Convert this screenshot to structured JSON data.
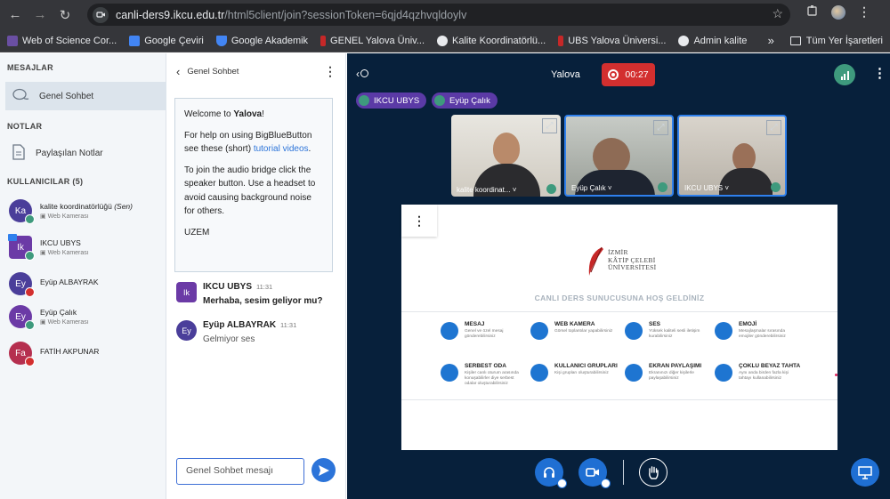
{
  "browser": {
    "url_domain": "canli-ders9.ikcu.edu.tr",
    "url_path": "/html5client/join?sessionToken=6qjd4qzhvqldoylv",
    "bookmarks": [
      {
        "label": "Web of Science Cor...",
        "color": "#5f6368"
      },
      {
        "label": "Google Çeviri",
        "color": "#4285f4"
      },
      {
        "label": "Google Akademik",
        "color": "#4285f4"
      },
      {
        "label": "GENEL Yalova Üniv...",
        "color": "#c62828"
      },
      {
        "label": "Kalite Koordinatörlü...",
        "color": "#e8eaed"
      },
      {
        "label": "UBS Yalova Üniversi...",
        "color": "#c62828"
      },
      {
        "label": "Admin kalite",
        "color": "#e8eaed"
      }
    ],
    "more": "»",
    "all_bookmarks": "Tüm Yer İşaretleri"
  },
  "sidebar": {
    "messages_header": "MESAJLAR",
    "public_chat": "Genel Sohbet",
    "notes_header": "NOTLAR",
    "shared_notes": "Paylaşılan Notlar",
    "users_header": "KULLANICILAR (5)",
    "users": [
      {
        "initials": "Ka",
        "name": "kalite koordinatörlüğü",
        "you": "(Sen)",
        "sub": "Web Kamerası",
        "color": "#4a3e9a",
        "badge": "#3e9a7d",
        "shape": "circle"
      },
      {
        "initials": "Ik",
        "name": "IKCU UBYS",
        "you": "",
        "sub": "Web Kamerası",
        "color": "#6b3aa6",
        "badge": "#3e9a7d",
        "shape": "square"
      },
      {
        "initials": "Ey",
        "name": "Eyüp ALBAYRAK",
        "you": "",
        "sub": "",
        "color": "#4a3e9a",
        "badge": "#d32f2f",
        "shape": "circle"
      },
      {
        "initials": "Ey",
        "name": "Eyüp Çalık",
        "you": "",
        "sub": "Web Kamerası",
        "color": "#6b3aa6",
        "badge": "#3e9a7d",
        "shape": "circle"
      },
      {
        "initials": "Fa",
        "name": "FATİH AKPUNAR",
        "you": "",
        "sub": "",
        "color": "#b52f4f",
        "badge": "#d32f2f",
        "shape": "circle"
      }
    ]
  },
  "chat": {
    "title": "Genel Sohbet",
    "welcome_title_prefix": "Welcome to ",
    "welcome_title_name": "Yalova",
    "welcome_title_suffix": "!",
    "help_text": "For help on using BigBlueButton see these (short) ",
    "help_link": "tutorial videos",
    "help_end": ".",
    "audio_text": "To join the audio bridge click the speaker button. Use a headset to avoid causing background noise for others.",
    "signature": "UZEM",
    "messages": [
      {
        "initials": "Ik",
        "name": "IKCU UBYS",
        "time": "11:31",
        "text": "Merhaba, sesim geliyor mu?",
        "color": "#6b3aa6",
        "bold": true
      },
      {
        "initials": "Ey",
        "name": "Eyüp ALBAYRAK",
        "time": "11:31",
        "text": "Gelmiyor ses",
        "color": "#4a3e9a",
        "bold": false
      }
    ],
    "input_placeholder": "Genel Sohbet mesajı"
  },
  "meeting": {
    "title": "Yalova",
    "recording_time": "00:27",
    "talking": [
      "IKCU UBYS",
      "Eyüp Çalık"
    ],
    "videos": [
      {
        "name": "kalite koordinat...",
        "speaking": false
      },
      {
        "name": "Eyüp Çalık",
        "speaking": true
      },
      {
        "name": "IKCU UBYS",
        "speaking": true
      }
    ]
  },
  "slide": {
    "university_line1": "İZMİR",
    "university_line2": "KÂTİP ÇELEBİ",
    "university_line3": "ÜNİVERSİTESİ",
    "welcome": "CANLI DERS SUNUCUSUNA HOŞ GELDİNİZ",
    "features": [
      {
        "title": "MESAJ",
        "desc": "Genel ve özel mesaj gönderebilirsiniz"
      },
      {
        "title": "WEB KAMERA",
        "desc": "Görsel toplantılar yapabilirsiniz"
      },
      {
        "title": "SES",
        "desc": "Yüksek kaliteli sesli iletişim kurabilirsiniz"
      },
      {
        "title": "EMOJİ",
        "desc": "Mesajlaşmalar sırasında emojiler gönderebilirsiniz"
      },
      {
        "title": "SERBEST ODA",
        "desc": "Kişiler canlı oturum arasında konuşabilirler diye serbest odalar oluşturabilirsiniz"
      },
      {
        "title": "KULLANICI GRUPLARI",
        "desc": "Kişi grupları oluşturabilirsiniz"
      },
      {
        "title": "EKRAN PAYLAŞIMI",
        "desc": "Ekranınızı diğer kişilerle paylaşabilirsiniz"
      },
      {
        "title": "ÇOKLU BEYAZ TAHTA",
        "desc": "Aynı anda birden fazla kişi tahtayı kullanabilirsiniz"
      }
    ]
  }
}
